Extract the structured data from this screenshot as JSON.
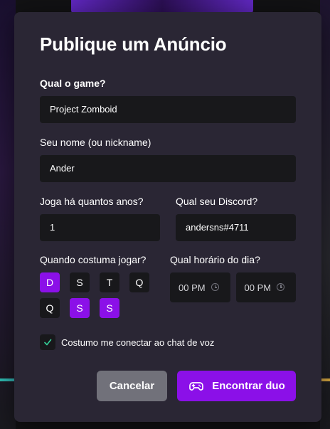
{
  "modal": {
    "title": "Publique um Anúncio"
  },
  "form": {
    "game": {
      "label": "Qual o game?",
      "value": "Project Zomboid"
    },
    "name": {
      "label": "Seu nome (ou nickname)",
      "value": "Ander"
    },
    "years": {
      "label": "Joga há quantos anos?",
      "value": "1"
    },
    "discord": {
      "label": "Qual seu Discord?",
      "value": "andersns#4711"
    },
    "days": {
      "label": "Quando costuma jogar?",
      "items": [
        {
          "label": "D",
          "selected": true
        },
        {
          "label": "S",
          "selected": false
        },
        {
          "label": "T",
          "selected": false
        },
        {
          "label": "Q",
          "selected": false
        },
        {
          "label": "Q",
          "selected": false
        },
        {
          "label": "S",
          "selected": true
        },
        {
          "label": "S",
          "selected": true
        }
      ]
    },
    "hours": {
      "label": "Qual horário do dia?",
      "start": "00 PM",
      "end": "00 PM"
    },
    "voice": {
      "label": "Costumo me conectar ao chat de voz",
      "checked": true
    }
  },
  "actions": {
    "cancel_label": "Cancelar",
    "submit_label": "Encontrar duo",
    "submit_icon": "game-controller-icon"
  },
  "colors": {
    "accent": "#8B10E8",
    "modal_bg": "#2A2634",
    "input_bg": "#18181B",
    "cancel_bg": "#71717A",
    "check": "#34D399"
  }
}
